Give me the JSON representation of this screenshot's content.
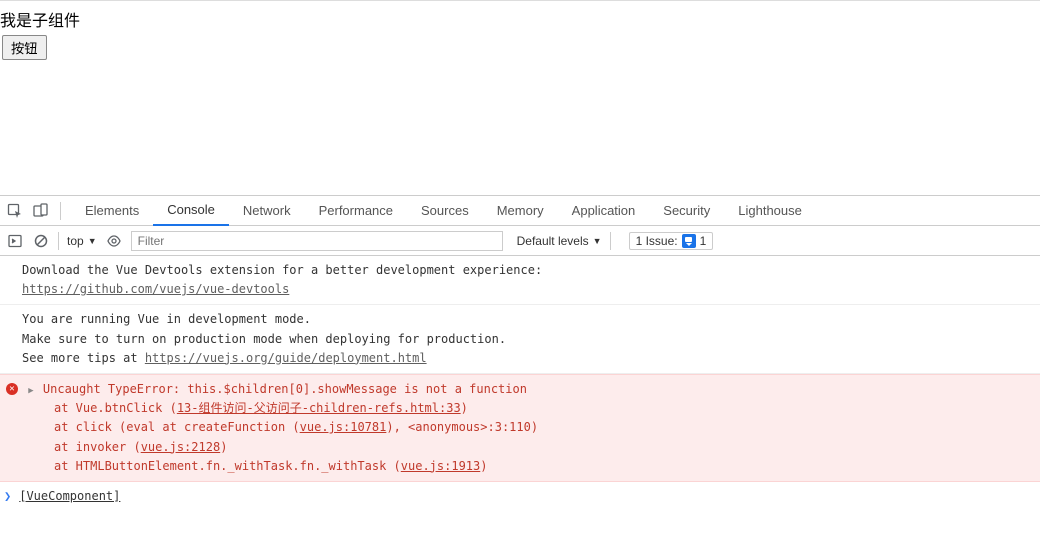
{
  "page": {
    "child_text": "我是子组件",
    "button_label": "按钮"
  },
  "devtools": {
    "tabs": {
      "elements": "Elements",
      "console": "Console",
      "network": "Network",
      "performance": "Performance",
      "sources": "Sources",
      "memory": "Memory",
      "application": "Application",
      "security": "Security",
      "lighthouse": "Lighthouse"
    },
    "toolbar": {
      "context": "top",
      "filter_placeholder": "Filter",
      "levels": "Default levels",
      "issues_label": "1 Issue:",
      "issues_count": "1"
    }
  },
  "console": {
    "log1_line1": "Download the Vue Devtools extension for a better development experience:",
    "log1_link": "https://github.com/vuejs/vue-devtools",
    "log2_line1": "You are running Vue in development mode.",
    "log2_line2": "Make sure to turn on production mode when deploying for production.",
    "log2_line3_prefix": "See more tips at ",
    "log2_link": "https://vuejs.org/guide/deployment.html",
    "error": {
      "message": "Uncaught TypeError: this.$children[0].showMessage is not a function",
      "stack1_prefix": "at Vue.btnClick (",
      "stack1_link": "13-组件访问-父访问子-children-refs.html:33",
      "stack1_suffix": ")",
      "stack2_prefix": "at click (eval at createFunction (",
      "stack2_link": "vue.js:10781",
      "stack2_suffix": "), <anonymous>:3:110)",
      "stack3_prefix": "at invoker (",
      "stack3_link": "vue.js:2128",
      "stack3_suffix": ")",
      "stack4_prefix": "at HTMLButtonElement.fn._withTask.fn._withTask (",
      "stack4_link": "vue.js:1913",
      "stack4_suffix": ")"
    },
    "prompt_value": "[VueComponent]"
  }
}
